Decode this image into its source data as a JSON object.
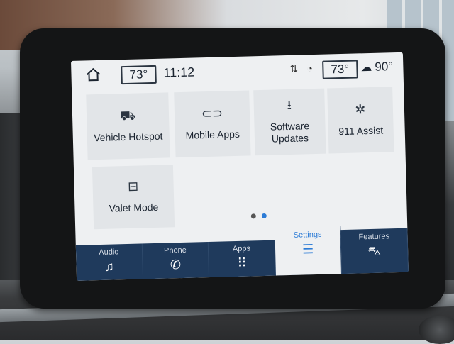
{
  "status_bar": {
    "home_icon": "home-icon",
    "cabin_temp": "73°",
    "time": "11:12",
    "signal_icon": "signal-arrows-icon",
    "wifi_icon": "wifi-icon",
    "passenger_temp": "73°",
    "weather_icon": "cloudy-sun-icon",
    "outside_temp": "90°"
  },
  "tiles": [
    {
      "label": "Vehicle Hotspot",
      "icon": "car-wifi-icon"
    },
    {
      "label": "Mobile Apps",
      "icon": "link-icon"
    },
    {
      "label": "Software Updates",
      "icon": "download-icon"
    },
    {
      "label": "911 Assist",
      "icon": "emergency-icon"
    },
    {
      "label": "Valet Mode",
      "icon": "car-lock-icon"
    }
  ],
  "pagination": {
    "total": 2,
    "active": 2
  },
  "nav": [
    {
      "label": "Audio",
      "icon": "music-note-icon"
    },
    {
      "label": "Phone",
      "icon": "phone-icon"
    },
    {
      "label": "Apps",
      "icon": "grid-icon"
    },
    {
      "label": "Settings",
      "icon": "sliders-icon",
      "active": true
    },
    {
      "label": "Features",
      "icon": "car-icon"
    }
  ],
  "colors": {
    "accent": "#2b7bd6",
    "nav_bg": "#1f3a5c"
  }
}
